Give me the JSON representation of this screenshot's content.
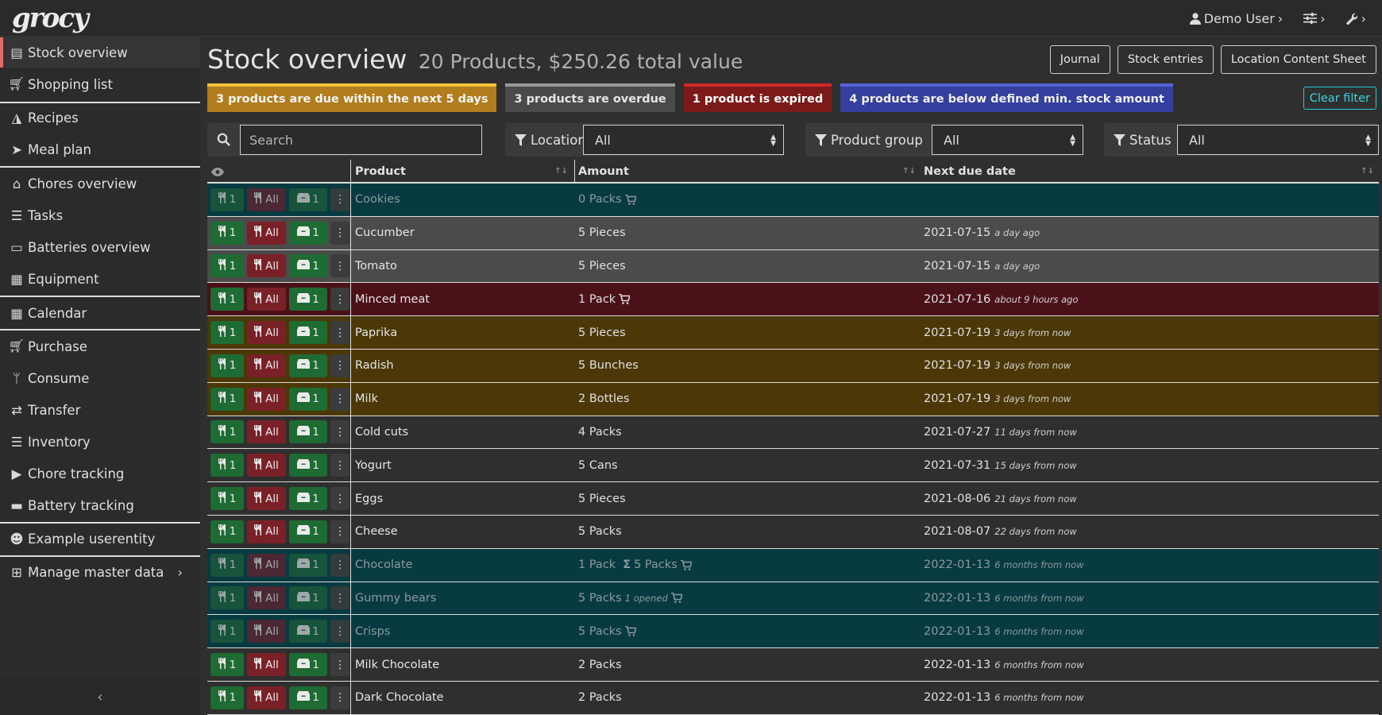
{
  "app": {
    "logo": "grocy"
  },
  "topbar": {
    "user": "Demo User"
  },
  "sidebar": {
    "items": [
      {
        "label": "Stock overview"
      },
      {
        "label": "Shopping list"
      },
      {
        "label": "Recipes"
      },
      {
        "label": "Meal plan"
      },
      {
        "label": "Chores overview"
      },
      {
        "label": "Tasks"
      },
      {
        "label": "Batteries overview"
      },
      {
        "label": "Equipment"
      },
      {
        "label": "Calendar"
      },
      {
        "label": "Purchase"
      },
      {
        "label": "Consume"
      },
      {
        "label": "Transfer"
      },
      {
        "label": "Inventory"
      },
      {
        "label": "Chore tracking"
      },
      {
        "label": "Battery tracking"
      },
      {
        "label": "Example userentity"
      },
      {
        "label": "Manage master data"
      }
    ]
  },
  "header": {
    "title": "Stock overview",
    "subtitle": "20 Products, $250.26 total value",
    "buttons": {
      "journal": "Journal",
      "stock_entries": "Stock entries",
      "location_sheet": "Location Content Sheet"
    }
  },
  "status": {
    "due": "3 products are due within the next 5 days",
    "overdue": "3 products are overdue",
    "expired": "1 product is expired",
    "below": "4 products are below defined min. stock amount",
    "clear_filter": "Clear filter"
  },
  "filters": {
    "search_placeholder": "Search",
    "location_label": "Location",
    "location_value": "All",
    "product_group_label": "Product group",
    "product_group_value": "All",
    "status_label": "Status",
    "status_value": "All"
  },
  "table": {
    "columns": {
      "product": "Product",
      "amount": "Amount",
      "next_due": "Next due date"
    },
    "action_labels": {
      "consume_one": "1",
      "consume_all": "All",
      "open_one": "1"
    },
    "rows": [
      {
        "product": "Cookies",
        "amount": "0 Packs",
        "date": "",
        "rel": ""
      },
      {
        "product": "Cucumber",
        "amount": "5 Pieces",
        "date": "2021-07-15",
        "rel": "a day ago"
      },
      {
        "product": "Tomato",
        "amount": "5 Pieces",
        "date": "2021-07-15",
        "rel": "a day ago"
      },
      {
        "product": "Minced meat",
        "amount": "1 Pack",
        "date": "2021-07-16",
        "rel": "about 9 hours ago"
      },
      {
        "product": "Paprika",
        "amount": "5 Pieces",
        "date": "2021-07-19",
        "rel": "3 days from now"
      },
      {
        "product": "Radish",
        "amount": "5 Bunches",
        "date": "2021-07-19",
        "rel": "3 days from now"
      },
      {
        "product": "Milk",
        "amount": "2 Bottles",
        "date": "2021-07-19",
        "rel": "3 days from now"
      },
      {
        "product": "Cold cuts",
        "amount": "4 Packs",
        "date": "2021-07-27",
        "rel": "11 days from now"
      },
      {
        "product": "Yogurt",
        "amount": "5 Cans",
        "date": "2021-07-31",
        "rel": "15 days from now"
      },
      {
        "product": "Eggs",
        "amount": "5 Pieces",
        "date": "2021-08-06",
        "rel": "21 days from now"
      },
      {
        "product": "Cheese",
        "amount": "5 Packs",
        "date": "2021-08-07",
        "rel": "22 days from now"
      },
      {
        "product": "Chocolate",
        "amount": "1 Pack",
        "amount_sum": "5 Packs",
        "date": "2022-01-13",
        "rel": "6 months from now"
      },
      {
        "product": "Gummy bears",
        "amount": "5 Packs",
        "opened": "1 opened",
        "date": "2022-01-13",
        "rel": "6 months from now"
      },
      {
        "product": "Crisps",
        "amount": "5 Packs",
        "date": "2022-01-13",
        "rel": "6 months from now"
      },
      {
        "product": "Milk Chocolate",
        "amount": "2 Packs",
        "date": "2022-01-13",
        "rel": "6 months from now"
      },
      {
        "product": "Dark Chocolate",
        "amount": "2 Packs",
        "date": "2022-01-13",
        "rel": "6 months from now"
      }
    ]
  },
  "colors": {
    "due": "#b17d1d",
    "overdue": "#4a4a4a",
    "expired": "#7c1a1a",
    "below": "#343f9e",
    "row_teal": "#083a42",
    "row_gray": "#4b4b4b",
    "row_red": "#4b1118",
    "row_amber": "#4b3806",
    "accent": "#e26b6b",
    "clear_filter": "#3cd2e2"
  }
}
